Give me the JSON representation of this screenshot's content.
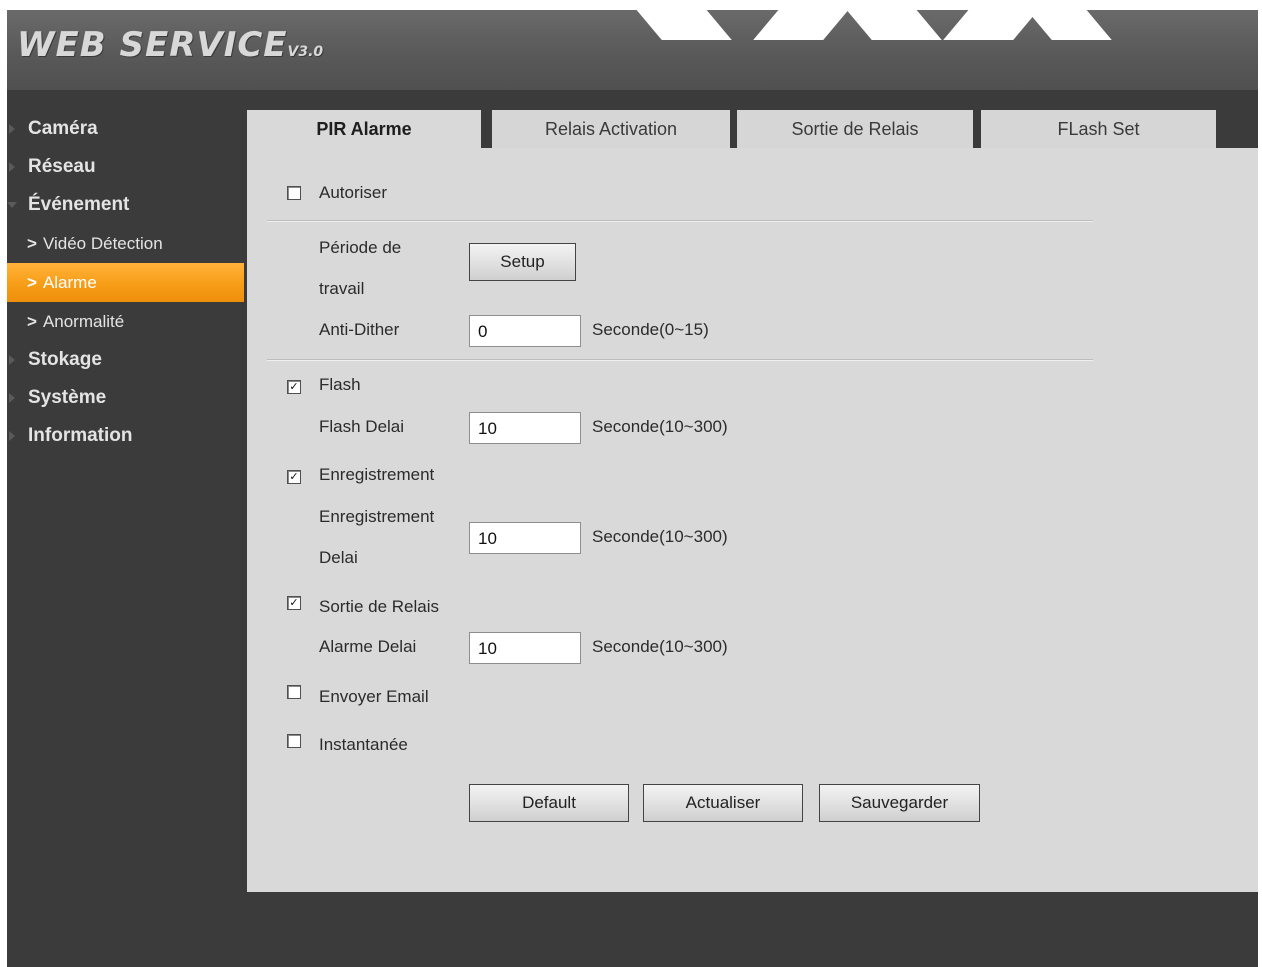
{
  "header": {
    "logo_text": "WEB SERVICE",
    "logo_version": "V3.0"
  },
  "sidebar": {
    "items": [
      {
        "label": "Caméra"
      },
      {
        "label": "Réseau"
      },
      {
        "label": "Événement"
      }
    ],
    "sub_items": [
      {
        "label": "Vidéo Détection"
      },
      {
        "label": "Alarme"
      },
      {
        "label": "Anormalité"
      }
    ],
    "items_after": [
      {
        "label": "Stokage"
      },
      {
        "label": "Système"
      },
      {
        "label": "Information"
      }
    ],
    "chevron": ">"
  },
  "tabs": [
    {
      "label": "PIR Alarme"
    },
    {
      "label": "Relais Activation"
    },
    {
      "label": "Sortie de Relais"
    },
    {
      "label": "FLash Set"
    }
  ],
  "form": {
    "autoriser": {
      "label": "Autoriser",
      "checked": false
    },
    "periode": {
      "label_line1": "Période de",
      "label_line2": "travail",
      "button": "Setup"
    },
    "anti_dither": {
      "label": "Anti-Dither",
      "value": "0",
      "unit": "Seconde(0~15)"
    },
    "flash": {
      "label": "Flash",
      "checked": true
    },
    "flash_delai": {
      "label": "Flash Delai",
      "value": "10",
      "unit": "Seconde(10~300)"
    },
    "enregistrement": {
      "label": "Enregistrement",
      "checked": true
    },
    "enregistrement_delai": {
      "label_line1": "Enregistrement",
      "label_line2": "Delai",
      "value": "10",
      "unit": "Seconde(10~300)"
    },
    "sortie_relais": {
      "label": "Sortie de Relais",
      "checked": true
    },
    "alarme_delai": {
      "label": "Alarme Delai",
      "value": "10",
      "unit": "Seconde(10~300)"
    },
    "envoyer_email": {
      "label": "Envoyer Email",
      "checked": false
    },
    "instantanee": {
      "label": "Instantanée",
      "checked": false
    },
    "check_mark": "✓"
  },
  "buttons": {
    "default": "Default",
    "actualiser": "Actualiser",
    "sauvegarder": "Sauvegarder"
  },
  "colors": {
    "accent": "#f79d17",
    "background": "#3b3b3b",
    "panel": "#d9d9d9"
  }
}
